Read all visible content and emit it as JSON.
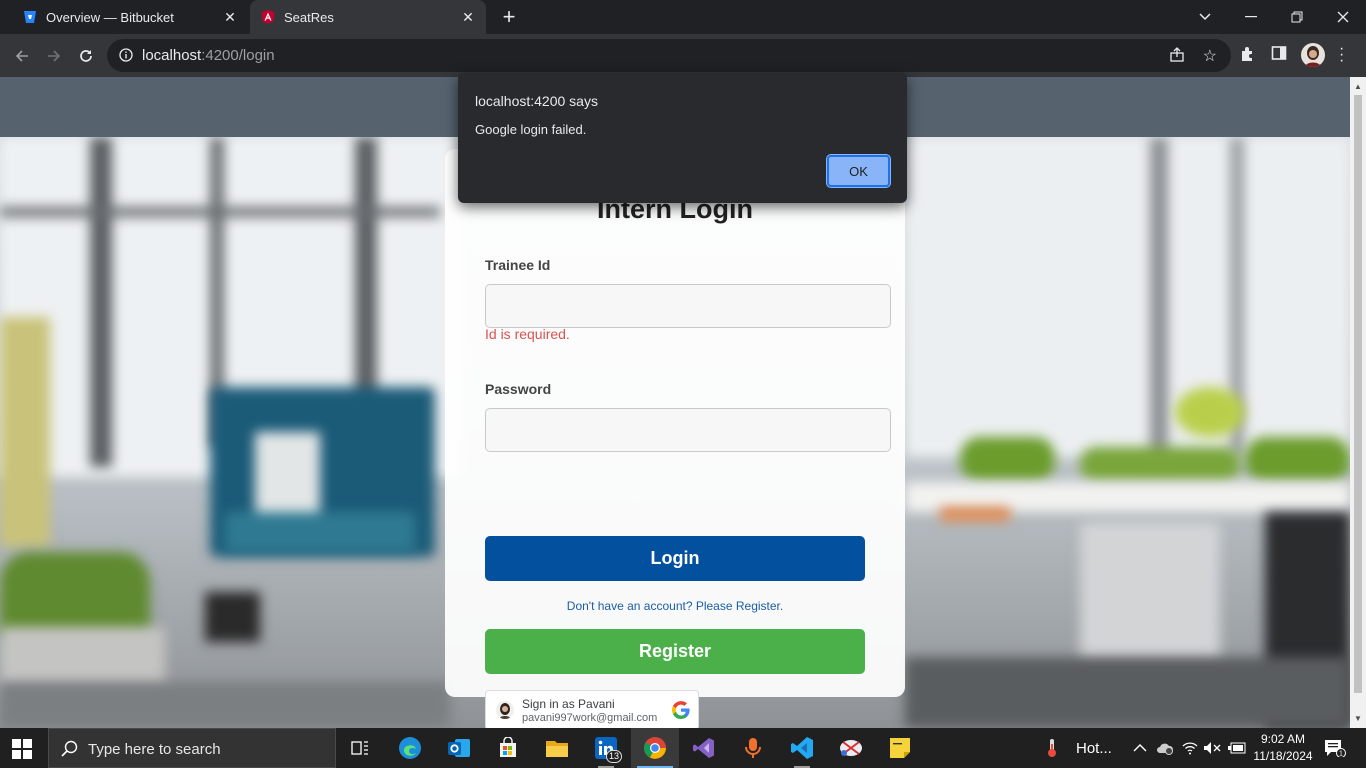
{
  "browser": {
    "tabs": [
      {
        "label": "Overview — Bitbucket",
        "active": false
      },
      {
        "label": "SeatRes",
        "active": true
      }
    ],
    "url_host": "localhost",
    "url_path": ":4200/login"
  },
  "dialog": {
    "title": "localhost:4200 says",
    "message": "Google login failed.",
    "ok_label": "OK"
  },
  "login": {
    "heading": "Intern Login",
    "trainee_label": "Trainee Id",
    "trainee_value": "",
    "trainee_error": "Id is required.",
    "password_label": "Password",
    "password_value": "",
    "login_button": "Login",
    "register_link": "Don't have an account? Please Register.",
    "register_button": "Register",
    "google": {
      "name": "Sign in as Pavani",
      "email": "pavani997work@gmail.com"
    }
  },
  "taskbar": {
    "search_placeholder": "Type here to search",
    "linkedin_badge": "13",
    "weather": "Hot...",
    "time": "9:02 AM",
    "date": "11/18/2024",
    "notification_count": "1",
    "colors": {
      "accent": "#6cb8f6",
      "background": "#202020"
    }
  },
  "colors": {
    "login_button": "#03509e",
    "register_button": "#4cb04a",
    "error_text": "#d9534f",
    "header_bar": "#56636f",
    "dialog_ok": "#8ab4f8"
  }
}
